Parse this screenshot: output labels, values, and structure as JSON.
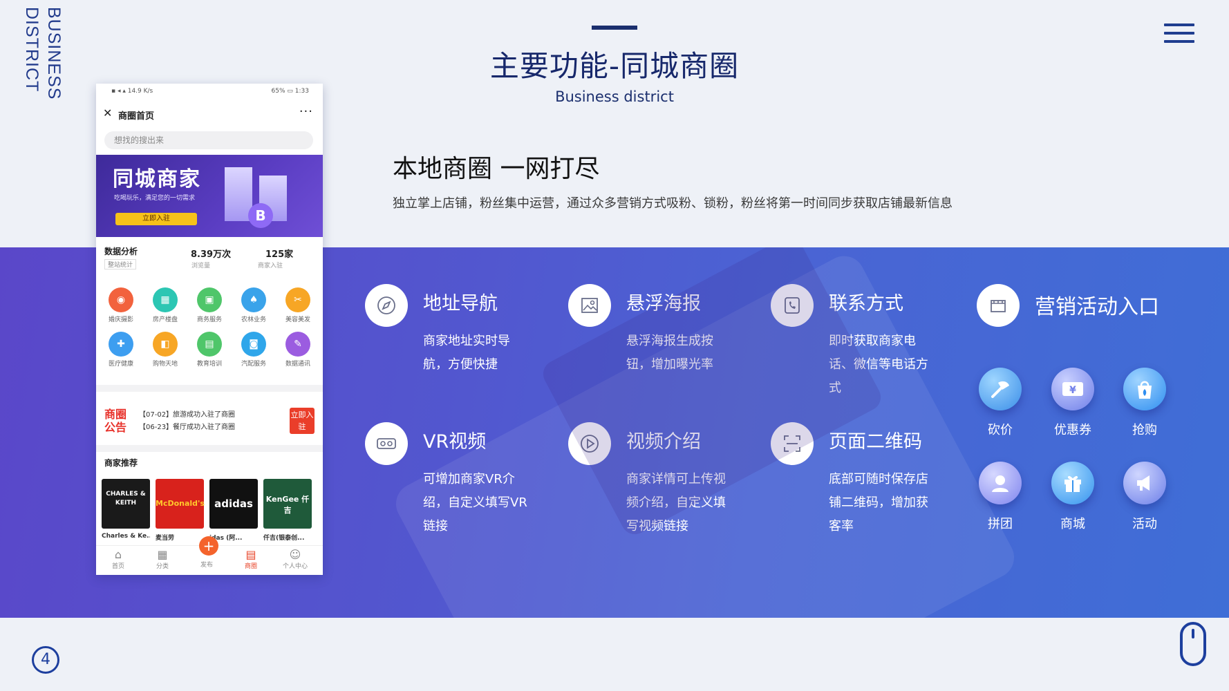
{
  "side_label": [
    "BUSINESS",
    "DISTRICT"
  ],
  "header": {
    "title": "主要功能-同城商圈",
    "subtitle": "Business district"
  },
  "intro": {
    "heading": "本地商圈 一网打尽",
    "description": "独立掌上店铺，粉丝集中运营，通过众多营销方式吸粉、锁粉，粉丝将第一时间同步获取店铺最新信息"
  },
  "features": [
    {
      "title": "地址导航",
      "desc": "商家地址实时导航，方便快捷",
      "icon": "compass-icon"
    },
    {
      "title": "悬浮海报",
      "desc": "悬浮海报生成按钮，增加曝光率",
      "icon": "image-icon"
    },
    {
      "title": "联系方式",
      "desc": "即时获取商家电话、微信等电话方式",
      "icon": "phone-icon"
    },
    {
      "title": "营销活动入口",
      "desc": "",
      "icon": "store-icon"
    },
    {
      "title": "VR视频",
      "desc": "可增加商家VR介绍，自定义填写VR链接",
      "icon": "vr-icon"
    },
    {
      "title": "视频介绍",
      "desc": "商家详情可上传视频介绍，自定义填写视频链接",
      "icon": "play-icon"
    },
    {
      "title": "页面二维码",
      "desc": "底部可随时保存店铺二维码，增加获客率",
      "icon": "scan-icon"
    }
  ],
  "marketing": [
    {
      "label": "砍价",
      "icon": "axe-icon",
      "color": "#4ea2ee"
    },
    {
      "label": "优惠券",
      "icon": "coupon-icon",
      "color": "#7d8ff0"
    },
    {
      "label": "抢购",
      "icon": "flame-bag-icon",
      "color": "#3d9ef2"
    },
    {
      "label": "拼团",
      "icon": "group-icon",
      "color": "#8c8ff2"
    },
    {
      "label": "商城",
      "icon": "gift-icon",
      "color": "#49a6f0"
    },
    {
      "label": "活动",
      "icon": "megaphone-icon",
      "color": "#7f90ef"
    }
  ],
  "phone": {
    "status_left": "▪ ◂ ▴ 14.9 K/s",
    "status_right": "65% ▭ 1:33",
    "nav_title": "商圈首页",
    "search_placeholder": "想找的搜出来",
    "banner": {
      "title": "同城商家",
      "subtitle": "吃喝玩乐，满足您的一切需求",
      "button": "立即入驻",
      "coin": "B"
    },
    "stats": {
      "label": "数据分析",
      "label_sub": "整站统计",
      "v1": "8.39万次",
      "v1_sub": "浏览量",
      "v2": "125家",
      "v2_sub": "商家入驻"
    },
    "grid": [
      {
        "label": "婚庆摄影",
        "color": "#f2623d",
        "glyph": "◉"
      },
      {
        "label": "房产楼盘",
        "color": "#2cc6b3",
        "glyph": "▦"
      },
      {
        "label": "商务服务",
        "color": "#4fc66a",
        "glyph": "▣"
      },
      {
        "label": "农林业务",
        "color": "#3aa3ea",
        "glyph": "♠"
      },
      {
        "label": "美容美发",
        "color": "#f7a625",
        "glyph": "✂"
      },
      {
        "label": "医疗健康",
        "color": "#3d9ef0",
        "glyph": "✚"
      },
      {
        "label": "购物天地",
        "color": "#f7a625",
        "glyph": "◧"
      },
      {
        "label": "教育培训",
        "color": "#4fc66a",
        "glyph": "▤"
      },
      {
        "label": "汽配服务",
        "color": "#2fa6ea",
        "glyph": "◙"
      },
      {
        "label": "数据通讯",
        "color": "#9b5ce0",
        "glyph": "✎"
      }
    ],
    "notice": {
      "logo": "商圈公告",
      "line1": "【07-02】旅游成功入驻了商圈",
      "line2": "【06-23】餐厅成功入驻了商圈",
      "button": "立即入驻"
    },
    "rec_title": "商家推荐",
    "brands": [
      {
        "logo": "CHARLES & KEITH",
        "name": "Charles & Ke...",
        "color": "#1a1a1a"
      },
      {
        "logo": "McDonald's",
        "name": "麦当劳",
        "color": "#d8221c"
      },
      {
        "logo": "adidas",
        "name": "idas (阿...",
        "color": "#111111"
      },
      {
        "logo": "KenGee 仟吉",
        "name": "仟吉(银泰创...",
        "color": "#1f5a3a"
      }
    ],
    "tabs": [
      {
        "label": "首页",
        "glyph": "⌂"
      },
      {
        "label": "分类",
        "glyph": "▦"
      },
      {
        "label": "发布",
        "glyph": "+"
      },
      {
        "label": "商圈",
        "glyph": "▤"
      },
      {
        "label": "个人中心",
        "glyph": "☺"
      }
    ]
  },
  "footer": {
    "page_number": "4"
  }
}
